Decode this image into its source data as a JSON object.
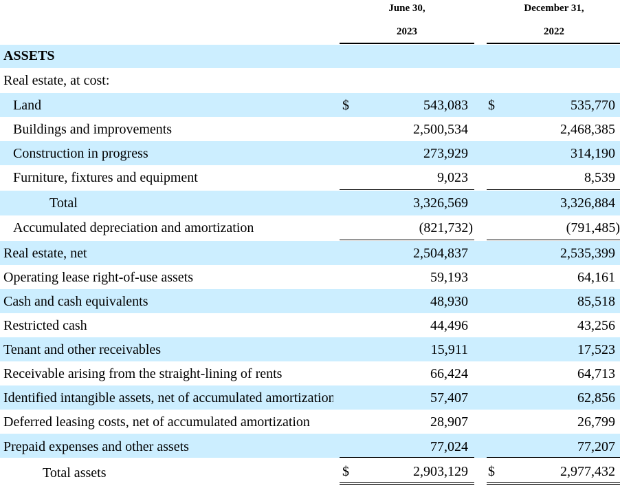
{
  "header": {
    "col1_line1": "June 30,",
    "col1_line2": "2023",
    "col2_line1": "December 31,",
    "col2_line2": "2022"
  },
  "sections": {
    "assets_title": "ASSETS",
    "real_estate_at_cost": "Real estate, at cost:"
  },
  "currency_symbol": "$",
  "rows": [
    {
      "label": "Land",
      "v2023": "543,083",
      "v2022": "535,770"
    },
    {
      "label": "Buildings and improvements",
      "v2023": "2,500,534",
      "v2022": "2,468,385"
    },
    {
      "label": "Construction in progress",
      "v2023": "273,929",
      "v2022": "314,190"
    },
    {
      "label": "Furniture, fixtures and equipment",
      "v2023": "9,023",
      "v2022": "8,539"
    },
    {
      "label": "Total",
      "v2023": "3,326,569",
      "v2022": "3,326,884"
    },
    {
      "label": "Accumulated depreciation and amortization",
      "v2023": "(821,732)",
      "v2022": "(791,485)"
    },
    {
      "label": "Real estate, net",
      "v2023": "2,504,837",
      "v2022": "2,535,399"
    },
    {
      "label": "Operating lease right-of-use assets",
      "v2023": "59,193",
      "v2022": "64,161"
    },
    {
      "label": "Cash and cash equivalents",
      "v2023": "48,930",
      "v2022": "85,518"
    },
    {
      "label": "Restricted cash",
      "v2023": "44,496",
      "v2022": "43,256"
    },
    {
      "label": "Tenant and other receivables",
      "v2023": "15,911",
      "v2022": "17,523"
    },
    {
      "label": "Receivable arising from the straight-lining of rents",
      "v2023": "66,424",
      "v2022": "64,713"
    },
    {
      "label": "Identified intangible assets, net of accumulated amortization",
      "v2023": "57,407",
      "v2022": "62,856"
    },
    {
      "label": "Deferred leasing costs, net of accumulated amortization",
      "v2023": "28,907",
      "v2022": "26,799"
    },
    {
      "label": "Prepaid expenses and other assets",
      "v2023": "77,024",
      "v2022": "77,207"
    },
    {
      "label": "Total assets",
      "v2023": "2,903,129",
      "v2022": "2,977,432"
    }
  ]
}
